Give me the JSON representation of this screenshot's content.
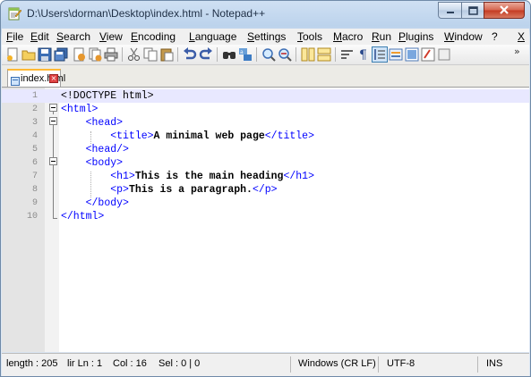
{
  "window": {
    "title": "D:\\Users\\dorman\\Desktop\\index.html - Notepad++",
    "controls": [
      "minimize",
      "maximize",
      "close"
    ]
  },
  "menu": {
    "items": [
      "File",
      "Edit",
      "Search",
      "View",
      "Encoding",
      "Language",
      "Settings",
      "Tools",
      "Macro",
      "Run",
      "Plugins",
      "Window",
      "?",
      "X"
    ]
  },
  "toolbar": {
    "icons": [
      "new-file-icon",
      "open-file-icon",
      "save-icon",
      "save-all-icon",
      "close-icon",
      "close-all-icon",
      "print-icon",
      "cut-icon",
      "copy-icon",
      "paste-icon",
      "undo-icon",
      "redo-icon",
      "find-icon",
      "replace-icon",
      "zoom-in-icon",
      "zoom-out-icon",
      "sync-vertical-icon",
      "sync-horizontal-icon",
      "word-wrap-icon",
      "show-all-chars-icon",
      "indent-guide-icon",
      "user-language-icon",
      "doc-map-icon",
      "function-list-icon",
      "more-icon"
    ],
    "overflow": "»"
  },
  "tab": {
    "label": "index.html",
    "close": "×"
  },
  "editor": {
    "lines": [
      {
        "n": "1",
        "html": "<span class='dtd'>&lt;!DOCTYPE html&gt;</span>"
      },
      {
        "n": "2",
        "html": "<span class='tag'>&lt;html&gt;</span>"
      },
      {
        "n": "3",
        "html": "    <span class='tag'>&lt;head&gt;</span>"
      },
      {
        "n": "4",
        "html": "        <span class='tag'>&lt;title&gt;</span><span class='txt'>A minimal web page</span><span class='tag'>&lt;/title&gt;</span>"
      },
      {
        "n": "5",
        "html": "    <span class='tag'>&lt;head/&gt;</span>"
      },
      {
        "n": "6",
        "html": "    <span class='tag'>&lt;body&gt;</span>"
      },
      {
        "n": "7",
        "html": "        <span class='tag'>&lt;h1&gt;</span><span class='txt'>This is the main heading</span><span class='tag'>&lt;/h1&gt;</span>"
      },
      {
        "n": "8",
        "html": "        <span class='tag'>&lt;p&gt;</span><span class='txt'>This is a paragraph.</span><span class='tag'>&lt;/p&gt;</span>"
      },
      {
        "n": "9",
        "html": "    <span class='tag'>&lt;/body&gt;</span>"
      },
      {
        "n": "10",
        "html": "<span class='tag'>&lt;/html&gt;</span>"
      }
    ],
    "current_line": 1
  },
  "status": {
    "length": "length : 205",
    "lines": "lir Ln : 1",
    "col": "Col : 16",
    "sel": "Sel : 0 | 0",
    "eol": "Windows (CR LF)",
    "encoding": "UTF-8",
    "mode": "INS"
  },
  "colors": {
    "tag": "#0000ff",
    "text": "#000000",
    "current_line_bg": "#e8e8ff",
    "gutter_bg": "#e4e4e4"
  }
}
